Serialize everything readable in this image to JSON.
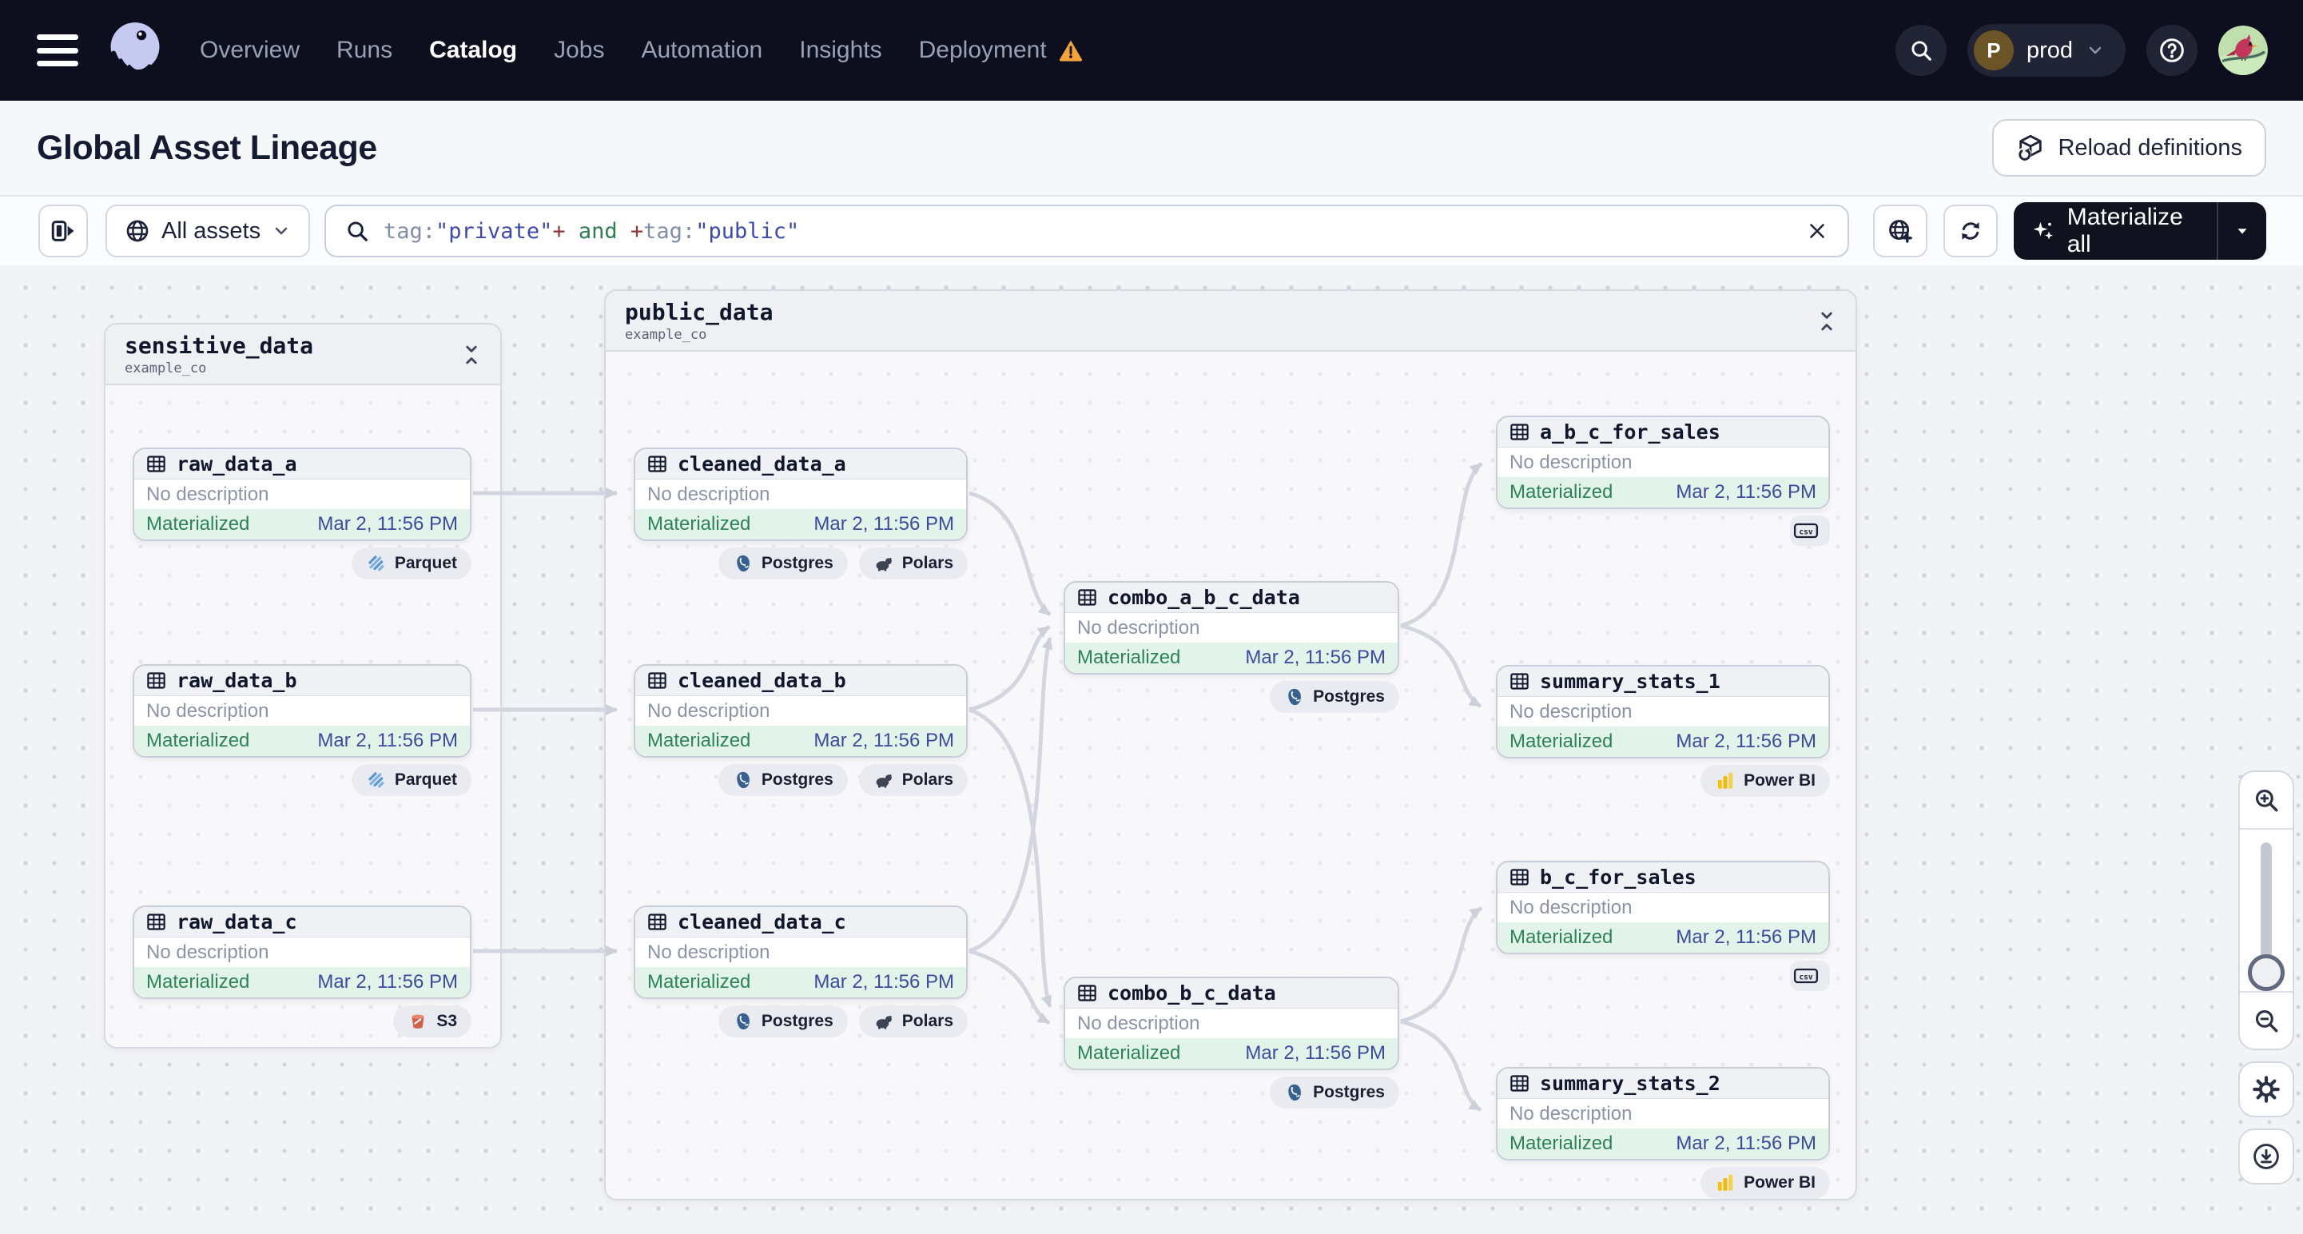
{
  "nav": {
    "items": [
      "Overview",
      "Runs",
      "Catalog",
      "Jobs",
      "Automation",
      "Insights",
      "Deployment"
    ],
    "active_item": "Catalog",
    "environment": {
      "initial": "P",
      "name": "prod"
    }
  },
  "header": {
    "title": "Global Asset Lineage",
    "reload_button": "Reload definitions"
  },
  "toolbar": {
    "scope_label": "All assets",
    "materialize_label": "Materialize all",
    "query_parts": [
      {
        "text": "tag:",
        "type": "key"
      },
      {
        "text": "\"private\"",
        "type": "value"
      },
      {
        "text": "+",
        "type": "plus"
      },
      {
        "text": " and ",
        "type": "and"
      },
      {
        "text": "+",
        "type": "plus"
      },
      {
        "text": "tag:",
        "type": "key"
      },
      {
        "text": "\"public\"",
        "type": "value"
      }
    ]
  },
  "groups": [
    {
      "name": "sensitive_data",
      "subtitle": "example_co"
    },
    {
      "name": "public_data",
      "subtitle": "example_co"
    }
  ],
  "nodes": [
    {
      "name": "raw_data_a",
      "description": "No description",
      "status": "Materialized",
      "timestamp": "Mar 2, 11:56 PM",
      "badges": [
        {
          "icon": "parquet",
          "label": "Parquet"
        }
      ]
    },
    {
      "name": "raw_data_b",
      "description": "No description",
      "status": "Materialized",
      "timestamp": "Mar 2, 11:56 PM",
      "badges": [
        {
          "icon": "parquet",
          "label": "Parquet"
        }
      ]
    },
    {
      "name": "raw_data_c",
      "description": "No description",
      "status": "Materialized",
      "timestamp": "Mar 2, 11:56 PM",
      "badges": [
        {
          "icon": "s3",
          "label": "S3"
        }
      ]
    },
    {
      "name": "cleaned_data_a",
      "description": "No description",
      "status": "Materialized",
      "timestamp": "Mar 2, 11:56 PM",
      "badges": [
        {
          "icon": "postgres",
          "label": "Postgres"
        },
        {
          "icon": "polars",
          "label": "Polars"
        }
      ]
    },
    {
      "name": "cleaned_data_b",
      "description": "No description",
      "status": "Materialized",
      "timestamp": "Mar 2, 11:56 PM",
      "badges": [
        {
          "icon": "postgres",
          "label": "Postgres"
        },
        {
          "icon": "polars",
          "label": "Polars"
        }
      ]
    },
    {
      "name": "cleaned_data_c",
      "description": "No description",
      "status": "Materialized",
      "timestamp": "Mar 2, 11:56 PM",
      "badges": [
        {
          "icon": "postgres",
          "label": "Postgres"
        },
        {
          "icon": "polars",
          "label": "Polars"
        }
      ]
    },
    {
      "name": "combo_a_b_c_data",
      "description": "No description",
      "status": "Materialized",
      "timestamp": "Mar 2, 11:56 PM",
      "badges": [
        {
          "icon": "postgres",
          "label": "Postgres"
        }
      ]
    },
    {
      "name": "combo_b_c_data",
      "description": "No description",
      "status": "Materialized",
      "timestamp": "Mar 2, 11:56 PM",
      "badges": [
        {
          "icon": "postgres",
          "label": "Postgres"
        }
      ]
    },
    {
      "name": "a_b_c_for_sales",
      "description": "No description",
      "status": "Materialized",
      "timestamp": "Mar 2, 11:56 PM",
      "badges": [
        {
          "icon": "csv",
          "label": ""
        }
      ]
    },
    {
      "name": "summary_stats_1",
      "description": "No description",
      "status": "Materialized",
      "timestamp": "Mar 2, 11:56 PM",
      "badges": [
        {
          "icon": "powerbi",
          "label": "Power BI"
        }
      ]
    },
    {
      "name": "b_c_for_sales",
      "description": "No description",
      "status": "Materialized",
      "timestamp": "Mar 2, 11:56 PM",
      "badges": [
        {
          "icon": "csv",
          "label": ""
        }
      ]
    },
    {
      "name": "summary_stats_2",
      "description": "No description",
      "status": "Materialized",
      "timestamp": "Mar 2, 11:56 PM",
      "badges": [
        {
          "icon": "powerbi",
          "label": "Power BI"
        }
      ]
    }
  ],
  "colors": {
    "status_green": "#2d8356",
    "timestamp_indigo": "#3c4a9f",
    "warning_orange": "#f2a33c",
    "query_key": "#818da6",
    "query_value": "#3e49ac",
    "query_plus": "#8f3637",
    "query_and": "#2f7d52",
    "nav_background": "#0d0f1e"
  }
}
